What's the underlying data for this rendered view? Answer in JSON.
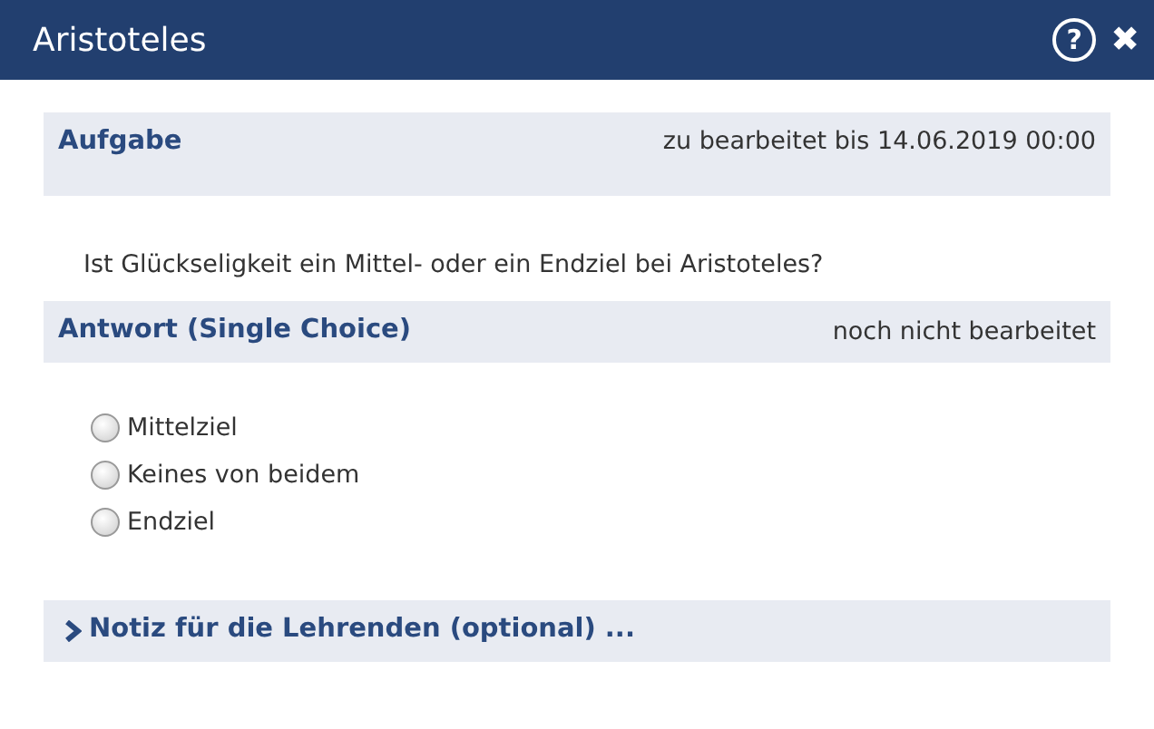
{
  "window": {
    "title": "Aristoteles",
    "help_button": "?",
    "close_button": "✖"
  },
  "task": {
    "heading": "Aufgabe",
    "deadline": "zu bearbeitet bis 14.06.2019 00:00",
    "question": "Ist Glückseligkeit ein Mittel- oder ein Endziel bei Aristoteles?"
  },
  "answer": {
    "heading": "Antwort (Single Choice)",
    "status": "noch nicht bearbeitet",
    "options": [
      {
        "label": "Mittelziel",
        "selected": false
      },
      {
        "label": "Keines von beidem",
        "selected": false
      },
      {
        "label": "Endziel",
        "selected": false
      }
    ]
  },
  "note": {
    "label": "Notiz für die Lehrenden (optional) ...",
    "expanded": false
  }
}
